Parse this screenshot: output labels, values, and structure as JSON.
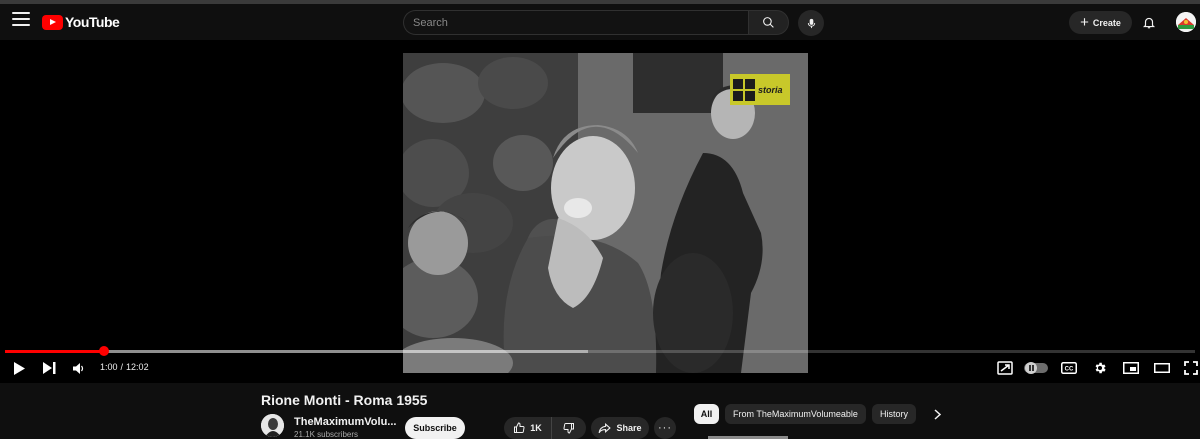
{
  "masthead": {
    "logo_text": "YouTube",
    "search_placeholder": "Search",
    "create_label": "Create"
  },
  "player": {
    "overlay_badge": "storia",
    "time_current": "1:00",
    "time_separator": "/",
    "time_total": "12:02",
    "progress_played_fraction": 0.083,
    "progress_buffered_fraction": 0.49
  },
  "video": {
    "title": "Rione Monti - Roma 1955",
    "channel_name": "TheMaximumVolu...",
    "subscribers": "21.1K subscribers",
    "subscribe_label": "Subscribe",
    "like_count": "1K",
    "share_label": "Share"
  },
  "chips": [
    {
      "label": "All",
      "active": true
    },
    {
      "label": "From TheMaximumVolumeable",
      "active": false
    },
    {
      "label": "History",
      "active": false
    }
  ],
  "colors": {
    "accent": "#ff0000",
    "background": "#0f0f0f",
    "surface": "#272727"
  }
}
